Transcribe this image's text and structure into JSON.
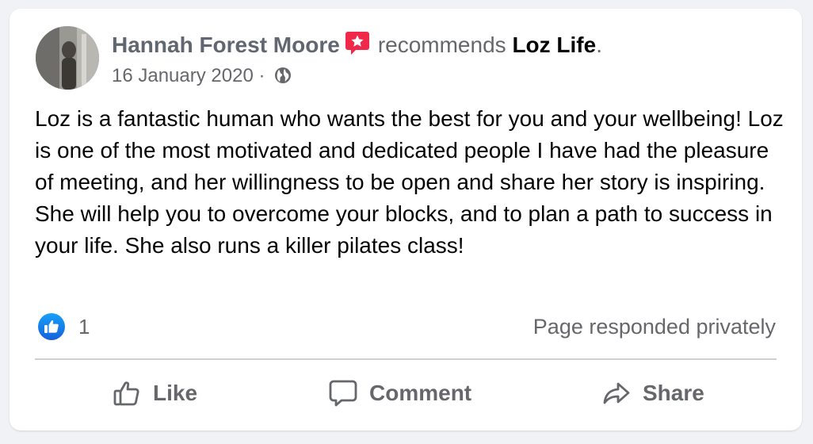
{
  "post": {
    "author": "Hannah Forest Moore",
    "verb": "recommends",
    "page_name": "Loz Life",
    "page_name_suffix": ".",
    "date": "16 January 2020",
    "separator": "·",
    "audience_icon": "globe-icon",
    "badge_icon": "recommend-star-icon",
    "text": "Loz is a fantastic human who wants the best for you and your wellbeing! Loz is one of the most motivated and dedicated people I have had the pleasure of meeting, and her willingness to be open and share her story is inspiring. She will help you to overcome your blocks, and to plan a path to success in your life. She also runs a killer pilates class!"
  },
  "reactions": {
    "icon": "thumbs-up-icon",
    "count": "1",
    "response_status": "Page responded privately"
  },
  "actions": {
    "like_label": "Like",
    "comment_label": "Comment",
    "share_label": "Share"
  },
  "colors": {
    "like_blue": "#1877f2",
    "badge_red": "#f02849",
    "secondary_text": "#65676b",
    "primary_text": "#050505"
  }
}
